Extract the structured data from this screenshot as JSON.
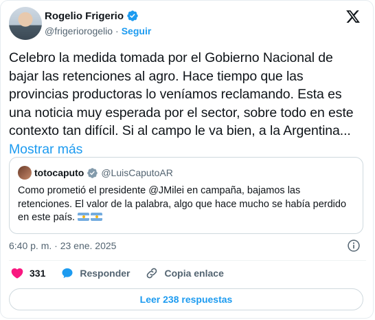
{
  "author": {
    "name": "Rogelio Frigerio",
    "handle": "@frigeriorogelio",
    "separator": "·",
    "follow_label": "Seguir"
  },
  "post": {
    "text": "Celebro la medida tomada por el Gobierno Nacional de bajar las retenciones al agro. Hace tiempo que las provincias productoras lo veníamos reclamando. Esta es una noticia muy esperada por el sector, sobre todo en este contexto tan difícil. Si al campo le va bien, a la Argentina...",
    "show_more": "Mostrar más",
    "timestamp": "6:40 p. m. · 23 ene. 2025"
  },
  "quote": {
    "name": "totocaputo",
    "handle": "@LuisCaputoAR",
    "text": "Como prometió el presidente @JMilei en campaña,  bajamos las retenciones. El valor de la palabra, algo que hace mucho se había perdido en este país. "
  },
  "actions": {
    "like_count": "331",
    "reply_label": "Responder",
    "copy_label": "Copia enlace"
  },
  "read_replies": "Leer 238 respuestas",
  "colors": {
    "accent": "#1d9bf0",
    "like": "#f91880",
    "verified": "#1d9bf0"
  }
}
